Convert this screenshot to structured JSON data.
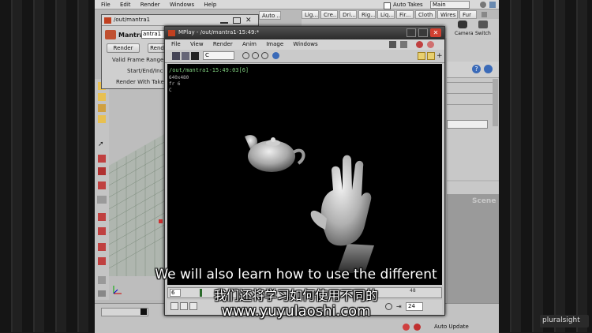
{
  "main_menu": [
    "File",
    "Edit",
    "Render",
    "Windows",
    "Help"
  ],
  "mantra_window": {
    "title": "/out/mantra1",
    "node_type": "Mantra",
    "node_name": "antra1",
    "render_btn": "Render",
    "render_btn2": "Rend",
    "params": [
      "Valid Frame Range",
      "Start/End/Inc",
      "Render With Take"
    ]
  },
  "autotakes": {
    "tab": "Auto ...",
    "label": "Auto Takes",
    "main": "Main"
  },
  "shelf_tabs": [
    "Lig...",
    "Cre...",
    "Dri...",
    "Rig...",
    "Liq...",
    "Fir...",
    "Cloth",
    "Wires",
    "Fur"
  ],
  "shelf_icons": [
    "Camera",
    "Switch"
  ],
  "mplay": {
    "title": "MPlay - /out/mantra1-15:49:*",
    "menu": [
      "File",
      "View",
      "Render",
      "Anim",
      "Image",
      "Windows"
    ],
    "channel": "C",
    "overlay": [
      "/out/mantra1-15:49:03[6]",
      "640x480",
      "fr 6",
      "C"
    ],
    "frame": "6",
    "ruler_mark": "48",
    "end_frame": "24"
  },
  "scene_label": "Scene",
  "auto_update": "Auto Update",
  "subtitle_en": "We will also learn how to use the different",
  "subtitle_zh": "我们还将学习如何使用不同的",
  "watermark": "www.yuyulaoshi.com",
  "logo": "pluralsight"
}
